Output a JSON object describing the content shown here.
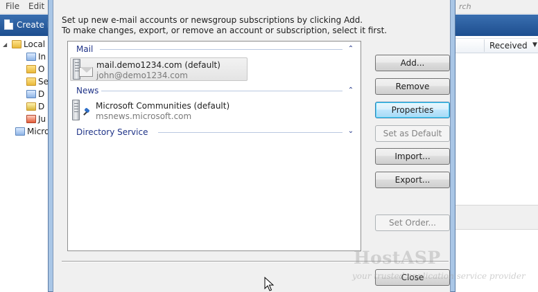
{
  "background": {
    "menu": [
      "File",
      "Edit"
    ],
    "search_hint": "rch",
    "toolbar_button": "Create M",
    "tree": [
      {
        "label": "Local",
        "icon": "folder-icon"
      },
      {
        "label": "In",
        "icon": "inbox-icon"
      },
      {
        "label": "O",
        "icon": "outbox-icon"
      },
      {
        "label": "Se",
        "icon": "sent-icon"
      },
      {
        "label": "D",
        "icon": "deleted-icon"
      },
      {
        "label": "D",
        "icon": "drafts-icon"
      },
      {
        "label": "Ju",
        "icon": "junk-icon"
      },
      {
        "label": "Micro",
        "icon": "server-icon"
      }
    ],
    "column_received": "Received"
  },
  "dialog": {
    "instruction_line1": "Set up new e-mail accounts or newsgroup subscriptions by clicking Add.",
    "instruction_line2": "To make changes, export, or remove an account or subscription, select it first.",
    "groups": {
      "mail": {
        "label": "Mail",
        "account": {
          "title": "mail.demo1234.com (default)",
          "subtitle": "john@demo1234.com"
        }
      },
      "news": {
        "label": "News",
        "account": {
          "title": "Microsoft Communities (default)",
          "subtitle": "msnews.microsoft.com"
        }
      },
      "directory": {
        "label": "Directory Service"
      }
    },
    "buttons": {
      "add": "Add...",
      "remove": "Remove",
      "properties": "Properties",
      "set_default": "Set as Default",
      "import": "Import...",
      "export": "Export...",
      "set_order": "Set Order...",
      "close": "Close"
    }
  },
  "watermark": {
    "main": "HostASP",
    "sub": "your trusted application service provider"
  }
}
